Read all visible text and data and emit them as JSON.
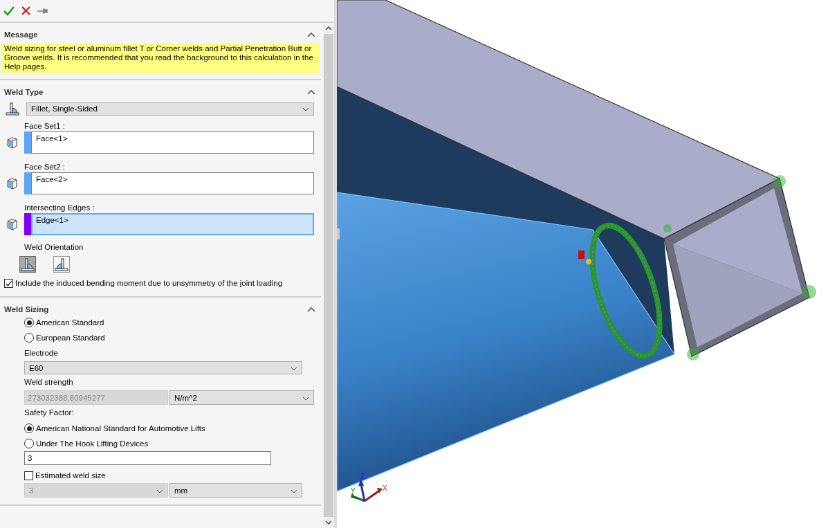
{
  "message": {
    "title": "Message",
    "expanded": true,
    "text": "Weld sizing for steel or aluminum fillet T or Corner welds and Partial Penetration Butt or Groove welds. It is recommended that you read the background to this calculation in the Help pages."
  },
  "weld_type": {
    "title": "Weld Type",
    "expanded": true,
    "type_value": "Fillet, Single-Sided",
    "selections": [
      {
        "label": "Face Set1 :",
        "value": "Face<1>",
        "color": "#5aa7f5",
        "active": false
      },
      {
        "label": "Face Set2 :",
        "value": "Face<2>",
        "color": "#5aa7f5",
        "active": false
      },
      {
        "label": "Intersecting Edges :",
        "value": "Edge<1>",
        "color": "#8000ff",
        "active": true
      }
    ],
    "orientation_label": "Weld Orientation",
    "orientations": [
      {
        "selected": true
      },
      {
        "selected": false
      }
    ],
    "bending": {
      "label": "Include the induced bending moment due to unsymmetry of the joint loading",
      "checked": true
    }
  },
  "weld_sizing": {
    "title": "Weld Sizing",
    "expanded": true,
    "standards": [
      {
        "label": "American Standard",
        "selected": true
      },
      {
        "label": "European Standard",
        "selected": false
      }
    ],
    "electrode_label": "Electrode",
    "electrode": "E60",
    "strength_label": "Weld strength",
    "strength_value": "273032388.80945277",
    "strength_unit": "N/m^2",
    "safety_label": "Safety Factor:",
    "safety_options": [
      {
        "label": "American National Standard for Automotive Lifts",
        "selected": true
      },
      {
        "label": "Under The Hook Lifting Devices",
        "selected": false
      }
    ],
    "safety_value": "3",
    "estimated": {
      "label": "Estimated weld size",
      "checked": false,
      "value": "3",
      "unit": "mm"
    }
  },
  "triad": {
    "x": "X",
    "y": "Y",
    "z": "Z"
  }
}
